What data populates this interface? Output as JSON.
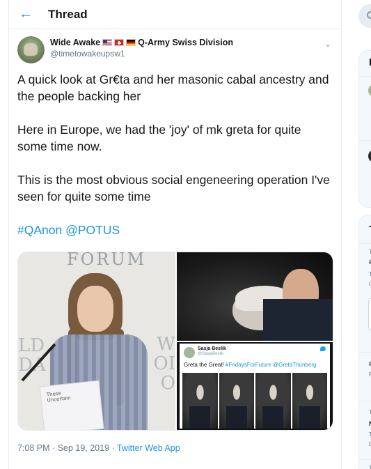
{
  "header": {
    "back_label": "←",
    "title": "Thread"
  },
  "tweet": {
    "display_name": "Wide Awake",
    "display_name_suffix": "Q-Army Swiss Division",
    "handle": "@timetowakeupsw1",
    "caret": "⌄",
    "paragraphs": [
      "A quick look at Gr€ta and her masonic cabal ancestry and the people backing her",
      "Here in Europe, we had the 'joy' of mk greta for quite some time now.",
      "This is the most obvious social engeneering operation I've seen for quite some time"
    ],
    "hashtag": "#QAnon",
    "mention": "@POTUS",
    "timestamp": "7:08 PM · Sep 19, 2019 · ",
    "app": "Twitter Web App"
  },
  "media": {
    "forum_text": "FORUM",
    "left_side_text": "LD\nDA",
    "right_side_text": "W\nOI\nO",
    "paper_text": "These\nUncertain",
    "embed": {
      "name": "Sasja Beslik",
      "handle": "@SasjaBeslik",
      "text_plain": "Greta the Great! ",
      "text_tags": "#FridaysForFuture @GretaThunberg"
    }
  },
  "sidebar": {
    "box1_heading": "F",
    "box2_heading": "T",
    "trend_labels": [
      "T",
      "#",
      "T",
      "C",
      "#",
      "F",
      "T",
      "N",
      "T",
      "D",
      "T"
    ]
  }
}
